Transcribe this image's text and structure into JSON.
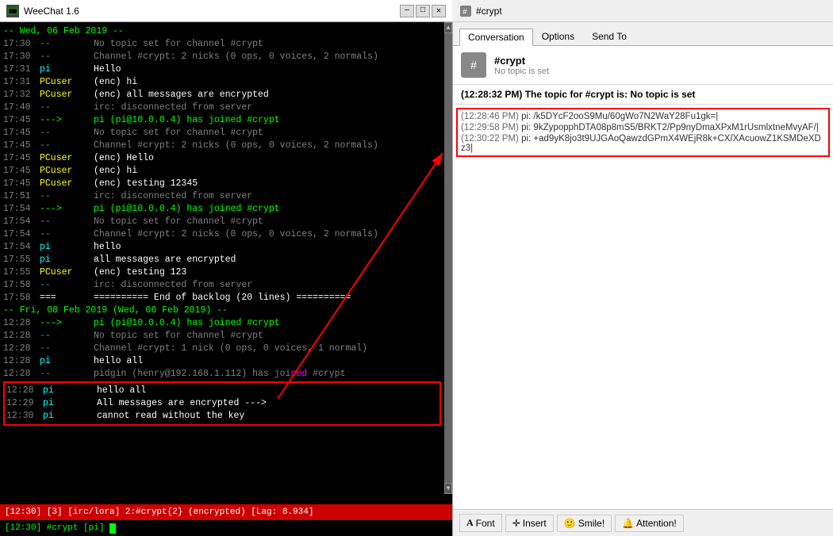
{
  "app": {
    "title": "WeeChat 1.6",
    "icon": "chat-icon"
  },
  "titlebar": {
    "title": "WeeChat 1.6",
    "minimize_label": "—",
    "maximize_label": "□",
    "close_label": "✕"
  },
  "status_bar": {
    "text": "[12:30]  [3]  [irc/lora]  2:#crypt{2}  (encrypted)   [Lag: 8.934]"
  },
  "input_bar": {
    "prompt": "[12:30]  #crypt  [pi]",
    "value": ""
  },
  "chat_lines": [
    {
      "time": "-- Wed, 06 Feb 2019 --",
      "nick": "",
      "msg": "",
      "type": "date"
    },
    {
      "time": "17:30",
      "nick": "--",
      "msg": "No topic set for channel #crypt",
      "time_color": "gray",
      "nick_color": "gray",
      "msg_color": "gray"
    },
    {
      "time": "17:30",
      "nick": "--",
      "msg": "Channel #crypt: 2 nicks (0 ops, 0 voices, 2 normals)",
      "time_color": "gray",
      "nick_color": "gray",
      "msg_color": "gray"
    },
    {
      "time": "17:31",
      "nick": "pi",
      "msg": "Hello",
      "time_color": "gray",
      "nick_color": "cyan",
      "msg_color": "white"
    },
    {
      "time": "17:31",
      "nick": "PCuser",
      "msg": "(enc) hi",
      "time_color": "gray",
      "nick_color": "yellow",
      "msg_color": "white"
    },
    {
      "time": "17:32",
      "nick": "PCuser",
      "msg": "(enc) all messages are encrypted",
      "time_color": "gray",
      "nick_color": "yellow",
      "msg_color": "white"
    },
    {
      "time": "17:40",
      "nick": "--",
      "msg": "irc: disconnected from server",
      "time_color": "gray",
      "nick_color": "gray",
      "msg_color": "gray"
    },
    {
      "time": "17:45",
      "nick": "--->",
      "msg": "pi (pi@10.0.0.4) has joined #crypt",
      "time_color": "gray",
      "nick_color": "green",
      "msg_color": "green"
    },
    {
      "time": "17:45",
      "nick": "--",
      "msg": "No topic set for channel #crypt",
      "time_color": "gray",
      "nick_color": "gray",
      "msg_color": "gray"
    },
    {
      "time": "17:45",
      "nick": "--",
      "msg": "Channel #crypt: 2 nicks (0 ops, 0 voices, 2 normals)",
      "time_color": "gray",
      "nick_color": "gray",
      "msg_color": "gray"
    },
    {
      "time": "17:45",
      "nick": "PCuser",
      "msg": "(enc) Hello",
      "time_color": "gray",
      "nick_color": "yellow",
      "msg_color": "white"
    },
    {
      "time": "17:45",
      "nick": "PCuser",
      "msg": "(enc) hi",
      "time_color": "gray",
      "nick_color": "yellow",
      "msg_color": "white"
    },
    {
      "time": "17:45",
      "nick": "PCuser",
      "msg": "(enc) testing 12345",
      "time_color": "gray",
      "nick_color": "yellow",
      "msg_color": "white"
    },
    {
      "time": "17:51",
      "nick": "--",
      "msg": "irc: disconnected from server",
      "time_color": "gray",
      "nick_color": "gray",
      "msg_color": "gray"
    },
    {
      "time": "17:54",
      "nick": "--->",
      "msg": "pi (pi@10.0.0.4) has joined #crypt",
      "time_color": "gray",
      "nick_color": "green",
      "msg_color": "green"
    },
    {
      "time": "17:54",
      "nick": "--",
      "msg": "No topic set for channel #crypt",
      "time_color": "gray",
      "nick_color": "gray",
      "msg_color": "gray"
    },
    {
      "time": "17:54",
      "nick": "--",
      "msg": "Channel #crypt: 2 nicks (0 ops, 0 voices, 2 normals)",
      "time_color": "gray",
      "nick_color": "gray",
      "msg_color": "gray"
    },
    {
      "time": "17:54",
      "nick": "pi",
      "msg": "hello",
      "time_color": "gray",
      "nick_color": "cyan",
      "msg_color": "white"
    },
    {
      "time": "17:55",
      "nick": "pi",
      "msg": "all messages are encrypted",
      "time_color": "gray",
      "nick_color": "cyan",
      "msg_color": "white"
    },
    {
      "time": "17:55",
      "nick": "PCuser",
      "msg": "(enc) testing 123",
      "time_color": "gray",
      "nick_color": "yellow",
      "msg_color": "white"
    },
    {
      "time": "17:58",
      "nick": "--",
      "msg": "irc: disconnected from server",
      "time_color": "gray",
      "nick_color": "gray",
      "msg_color": "gray"
    },
    {
      "time": "17:58",
      "nick": "===",
      "msg": "========== End of backlog (20 lines) ==========",
      "time_color": "gray",
      "nick_color": "white",
      "msg_color": "white"
    },
    {
      "time": "-- Fri, 08 Feb 2019 (Wed, 06 Feb 2019) --",
      "nick": "",
      "msg": "",
      "type": "date"
    },
    {
      "time": "12:28",
      "nick": "--->",
      "msg": "pi (pi@10.0.0.4) has joined #crypt",
      "time_color": "gray",
      "nick_color": "green",
      "msg_color": "green"
    },
    {
      "time": "12:28",
      "nick": "--",
      "msg": "No topic set for channel #crypt",
      "time_color": "gray",
      "nick_color": "gray",
      "msg_color": "gray"
    },
    {
      "time": "12:28",
      "nick": "--",
      "msg": "Channel #crypt: 1 nick (0 ops, 0 voices, 1 normal)",
      "time_color": "gray",
      "nick_color": "gray",
      "msg_color": "gray"
    },
    {
      "time": "12:28",
      "nick": "pi",
      "msg": "hello all",
      "time_color": "gray",
      "nick_color": "cyan",
      "msg_color": "white"
    },
    {
      "time": "12:28",
      "nick": "--",
      "msg": "pidgin (henry@192.168.1.112) has joined #crypt",
      "time_color": "gray",
      "nick_color": "gray",
      "msg_color": "gray"
    },
    {
      "time": "12:28",
      "nick": "pi",
      "msg": "hello all",
      "time_color": "gray",
      "nick_color": "cyan",
      "msg_color": "white",
      "highlighted": true
    },
    {
      "time": "12:29",
      "nick": "pi",
      "msg": "All messages are encrypted --->",
      "time_color": "gray",
      "nick_color": "cyan",
      "msg_color": "white",
      "highlighted": true
    },
    {
      "time": "12:30",
      "nick": "pi",
      "msg": "cannot read without the key",
      "time_color": "gray",
      "nick_color": "cyan",
      "msg_color": "white",
      "highlighted": true
    }
  ],
  "right_panel": {
    "title": "#crypt",
    "tabs": [
      "Conversation",
      "Options",
      "Send To"
    ],
    "active_tab": "Conversation",
    "channel": {
      "name": "#crypt",
      "topic": "No topic is set"
    },
    "topic_bar": "The topic for #crypt is: No topic is set",
    "messages": [
      {
        "time": "12:28:46 PM",
        "sender": "pi:",
        "text": "/k5DYcF2ooS9Mu/60gWo7N2WaY28Fu1gk=|",
        "highlighted": true
      },
      {
        "time": "12:29:58 PM",
        "sender": "pi:",
        "text": "9kZypopphDTA08p8mS5/BRKT2/Pp9nyDmaXPxM1rUsmlxtneMvyAF/|",
        "highlighted": true
      },
      {
        "time": "12:30:22 PM",
        "sender": "pi:",
        "text": "+ad9yK8jo3t9UJGAoQawzdGPmX4WEjR8k+CX/XAcuowZ1KSMDeXDz3|",
        "highlighted": true
      }
    ],
    "toolbar": {
      "font_label": "Font",
      "insert_label": "Insert",
      "smile_label": "Smile!",
      "attention_label": "Attention!"
    }
  }
}
